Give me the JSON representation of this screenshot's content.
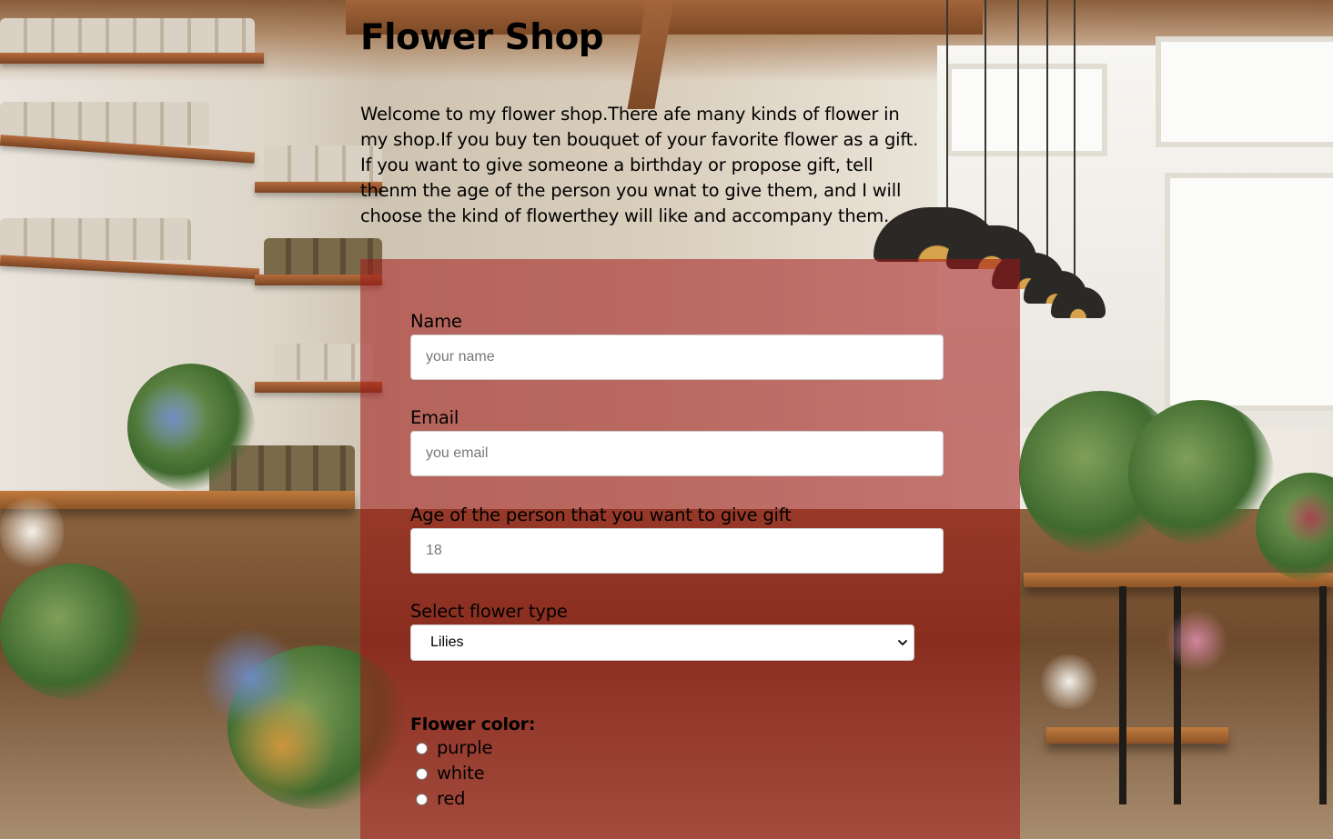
{
  "page": {
    "title": "Flower Shop",
    "intro": "Welcome to my flower shop.There afe many kinds of flower in my shop.If you buy ten bouquet of your favorite flower as a gift. If you want to give someone a birthday or propose gift, tell thenm the age of the person you wnat to give them, and I will choose the kind of flowerthey will like and accompany them."
  },
  "form": {
    "name": {
      "label": "Name",
      "placeholder": "your name",
      "value": ""
    },
    "email": {
      "label": "Email",
      "placeholder": "you email",
      "value": ""
    },
    "age": {
      "label": "Age of the person that you want to give gift",
      "placeholder": "18",
      "value": ""
    },
    "flower_type": {
      "label": "Select flower type",
      "selected": "Lilies",
      "icon": "chevron-down-icon"
    },
    "flower_color": {
      "legend": "Flower color:",
      "options": [
        {
          "label": "purple",
          "checked": false
        },
        {
          "label": "white",
          "checked": false
        },
        {
          "label": "red",
          "checked": false
        }
      ]
    }
  },
  "colors": {
    "form_panel": "#a01616",
    "text": "#000000"
  }
}
